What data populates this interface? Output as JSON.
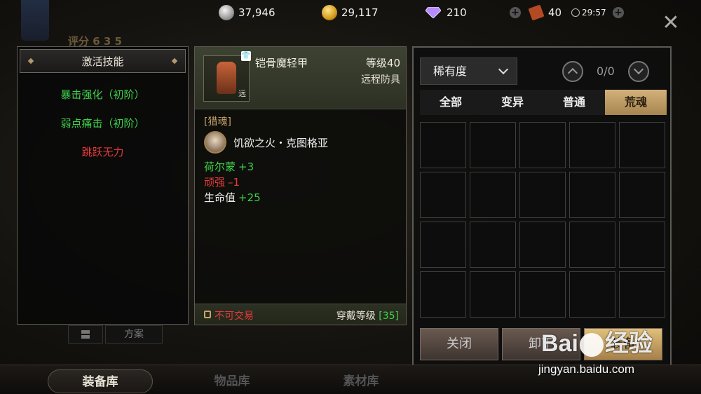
{
  "resources": {
    "silver": "37,946",
    "gold": "29,117",
    "diamond": "210",
    "ticket": "40",
    "timer": "29:57"
  },
  "background": {
    "score_label": "评分 6 3 5"
  },
  "left_panel": {
    "title": "激活技能",
    "skills": [
      {
        "name": "暴击强化（初阶）",
        "color": "#3fd24a"
      },
      {
        "name": "弱点痛击（初阶）",
        "color": "#3fd24a"
      },
      {
        "name": "跳跃无力",
        "color": "#e53a3a"
      }
    ],
    "scheme_label": "方案"
  },
  "item": {
    "name": "铠骨魔轻甲",
    "level": "等级40",
    "type": "远程防具",
    "slot_badge": "远",
    "tag": "[猎魂]",
    "soul_name": "饥欲之火・克图格亚",
    "stats": [
      {
        "name": "荷尔蒙",
        "value": "+3",
        "color": "#3fd24a"
      },
      {
        "name": "顽强",
        "value": "–1",
        "color": "#e53a3a"
      },
      {
        "name": "生命值",
        "value": "+25",
        "color": "#3fd24a",
        "name_color": "#eeeeee"
      }
    ],
    "trade": "不可交易",
    "wear_label": "穿戴等级",
    "wear_level": "[35]"
  },
  "right_panel": {
    "rarity_select": "稀有度",
    "page_indicator": "0/0",
    "tabs": [
      "全部",
      "变异",
      "普通",
      "荒魂"
    ],
    "active_tab": 3,
    "buttons": [
      "关闭",
      "卸下",
      "装备"
    ]
  },
  "bottom_nav": [
    "装备库",
    "物品库",
    "素材库"
  ],
  "watermark": {
    "brand": "Bai",
    "suffix": "经验",
    "url": "jingyan.baidu.com"
  },
  "colors": {
    "accent_gold": "#c9a56b",
    "positive": "#3fd24a",
    "negative": "#e53a3a"
  }
}
